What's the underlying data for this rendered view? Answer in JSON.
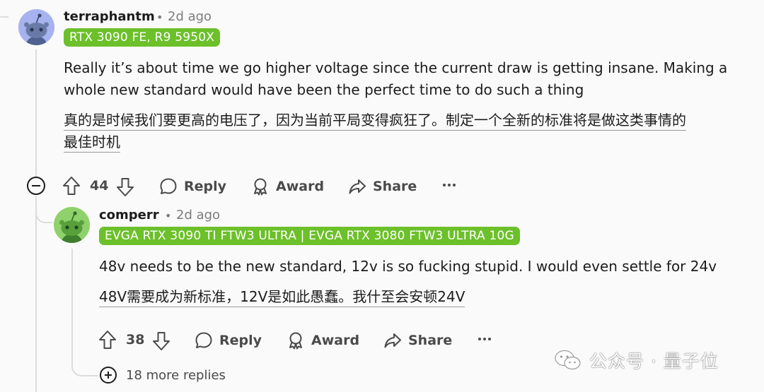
{
  "comment": {
    "username": "terraphantm",
    "separator": "•",
    "time": "2d ago",
    "flair": "RTX 3090 FE, R9 5950X",
    "flair_color": "#6cc02a",
    "body": {
      "line1": "Really it’s about time we go higher voltage since the current draw is getting insane. Making a",
      "line2": "whole new standard would have been the perfect time to do such a thing"
    },
    "translation": {
      "line1": "真的是时候我们要更高的电压了，因为当前平局变得疯狂了。制定一个全新的标准将是做这类事情的",
      "line2": "最佳时机"
    },
    "actions": {
      "upvote_icon": "upvote-arrow-icon",
      "votes": "44",
      "downvote_icon": "downvote-arrow-icon",
      "reply_label": "Reply",
      "award_label": "Award",
      "share_label": "Share",
      "more_icon": "ellipsis-icon"
    }
  },
  "reply": {
    "username": "comperr",
    "separator": "•",
    "time": "2d ago",
    "flair": "EVGA RTX 3090 TI FTW3 ULTRA | EVGA RTX 3080 FTW3 ULTRA 10G",
    "flair_color": "#6cc02a",
    "body": "48v needs to be the new standard, 12v is so fucking stupid. I would even settle for 24v",
    "translation": "48V需要成为新标准，12V是如此愚蠢。我什至会安顿24V",
    "actions": {
      "votes": "38",
      "reply_label": "Reply",
      "award_label": "Award",
      "share_label": "Share"
    },
    "more_replies": "18 more replies"
  },
  "watermark": {
    "text": "公众号 · 量子位"
  },
  "colors": {
    "background": "#fafafa",
    "text": "#1c1c1c",
    "muted": "#7c7c7c",
    "flair": "#6cc02a",
    "avatar1_bg": "#a7b3ee",
    "avatar2_bg": "#8fd16a"
  }
}
